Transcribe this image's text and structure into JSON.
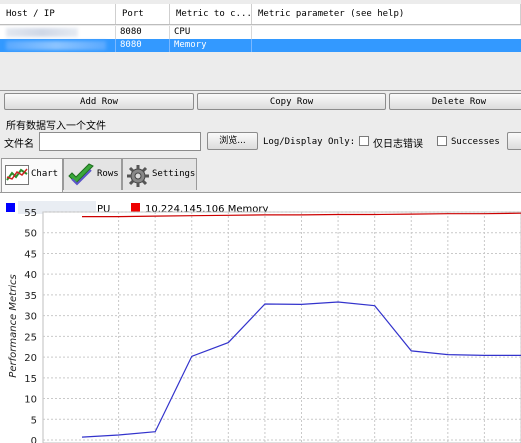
{
  "table": {
    "headers": [
      "Host / IP",
      "Port",
      "Metric to c...",
      "Metric parameter (see help)"
    ],
    "rows": [
      {
        "host": "",
        "port": "8080",
        "metric": "CPU",
        "param": "",
        "selected": false
      },
      {
        "host": "",
        "port": "8080",
        "metric": "Memory",
        "param": "",
        "selected": true
      }
    ]
  },
  "buttons": {
    "add_row": "Add Row",
    "copy_row": "Copy Row",
    "delete_row": "Delete Row"
  },
  "file": {
    "section_title": "所有数据写入一个文件",
    "file_label": "文件名",
    "file_value": "",
    "browse_label": "浏览...",
    "log_display_label": "Log/Display Only:",
    "errors_label": "仅日志错误",
    "successes_label": "Successes"
  },
  "tabs": [
    {
      "label": "Chart",
      "icon": "chart-icon",
      "active": true
    },
    {
      "label": "Rows",
      "icon": "checkmark-icon",
      "active": false
    },
    {
      "label": "Settings",
      "icon": "gear-icon",
      "active": false
    }
  ],
  "colors": {
    "selection": "#3399ff",
    "cpu": "#3333cc",
    "memory": "#cc0000",
    "legend_cpu": "#0000ff",
    "legend_memory": "#ee0000"
  },
  "chart_data": {
    "type": "line",
    "ylabel": "Performance Metrics",
    "ylim": [
      0,
      55
    ],
    "yticks": [
      0,
      5,
      10,
      15,
      20,
      25,
      30,
      35,
      40,
      45,
      50,
      55
    ],
    "grid": true,
    "legend": [
      {
        "name": "PU",
        "color": "#0000ff"
      },
      {
        "name": "10.224.145.106 Memory",
        "color": "#ee0000"
      }
    ],
    "series": [
      {
        "name": "CPU",
        "color": "#3333cc",
        "x": [
          0,
          1,
          2,
          3,
          4,
          5,
          6,
          7,
          8,
          9,
          10,
          11,
          12
        ],
        "values": [
          0.7,
          1.2,
          2.0,
          20.2,
          23.5,
          32.8,
          32.7,
          33.3,
          32.4,
          21.5,
          20.6,
          20.4,
          20.4
        ]
      },
      {
        "name": "Memory",
        "color": "#cc0000",
        "x": [
          0,
          1,
          2,
          3,
          4,
          5,
          6,
          7,
          8,
          9,
          10,
          11,
          12
        ],
        "values": [
          53.9,
          53.9,
          54.0,
          54.1,
          54.2,
          54.3,
          54.3,
          54.4,
          54.4,
          54.5,
          54.6,
          54.6,
          54.7
        ]
      }
    ]
  }
}
